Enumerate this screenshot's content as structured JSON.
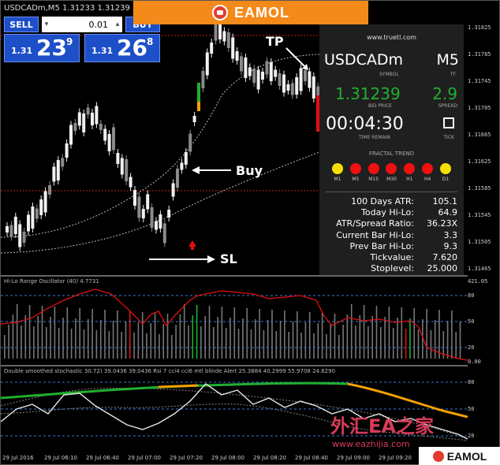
{
  "chart_header": {
    "symbol_line": "USDCADm,M5  1.31233 1.31239 1.31..."
  },
  "trade_panel": {
    "sell_label": "SELL",
    "buy_label": "BUY",
    "lot_value": "0.01",
    "bid": {
      "prefix": "1.31",
      "big": "23",
      "sup": "9"
    },
    "ask": {
      "prefix": "1.31",
      "big": "26",
      "sup": "8"
    }
  },
  "logo": {
    "text": "EAMOL"
  },
  "info_panel": {
    "site": "www.truetl.com",
    "symbol": "USDCADm",
    "symbol_caption": "SYMBOL",
    "timeframe": "M5",
    "timeframe_caption": "TF",
    "bid_price": "1.31239",
    "bid_caption": "BID PRICE",
    "spread": "2.9",
    "spread_caption": "SPREAD",
    "time_remain": "00:04:30",
    "time_caption": "TIME REMAIN",
    "tick_caption": "TICK",
    "fractal_title": "FRACTAL TREND",
    "fractal": [
      {
        "tf": "M1",
        "color": "#f5e000"
      },
      {
        "tf": "M5",
        "color": "#f01010"
      },
      {
        "tf": "M15",
        "color": "#f01010"
      },
      {
        "tf": "M30",
        "color": "#f01010"
      },
      {
        "tf": "H1",
        "color": "#f01010"
      },
      {
        "tf": "H4",
        "color": "#f01010"
      },
      {
        "tf": "D1",
        "color": "#f5e000"
      }
    ],
    "stats": [
      {
        "k": "100 Days ATR:",
        "v": "105.1"
      },
      {
        "k": "Today Hi-Lo:",
        "v": "64.9"
      },
      {
        "k": "ATR/Spread Ratio:",
        "v": "36.23X"
      },
      {
        "k": "Current Bar Hi-Lo:",
        "v": "3.3"
      },
      {
        "k": "Prev Bar Hi-Lo:",
        "v": "9.3"
      },
      {
        "k": "Tickvalue:",
        "v": "7.620"
      },
      {
        "k": "Stoplevel:",
        "v": "25.000"
      }
    ]
  },
  "annotations": {
    "tp": "TP",
    "buy": "Buy",
    "sl": "SL"
  },
  "price_axis": [
    "1.31825",
    "1.31785",
    "1.31745",
    "1.31705",
    "1.31665",
    "1.31625",
    "1.31585",
    "1.31545",
    "1.31505",
    "1.31465"
  ],
  "osc1": {
    "title": "Hi-Lo Range Oscillator (40) 4.7731",
    "axis": [
      "421.05",
      "80",
      "50",
      "20",
      "0.00"
    ]
  },
  "osc2": {
    "title": "Double smoothed stochastic 30.72) 39.0436 39.0436  Rsi 7 cci4 cci6 mtl  blinde Alert 25.3884 40.2999 55.9708 24.6290",
    "axis": [
      "80",
      "50",
      "20"
    ]
  },
  "time_axis": [
    "29 Jul 2016",
    "29 Jul 06:10",
    "29 Jul 06:40",
    "29 Jul 07:00",
    "29 Jul 07:20",
    "29 Jul 08:00",
    "29 Jul 08:20",
    "29 Jul 08:40",
    "29 Jul 09:00",
    "29 Jul 09:20",
    "29 Jul 09:40"
  ],
  "watermark": {
    "cn": "外汇EA之家",
    "url": "www.eazhijia.com"
  },
  "colors": {
    "bull": "#f0f0f0",
    "bear": "#8a8a8a",
    "green": "#20b030",
    "red": "#e01010",
    "orange": "#f4a000"
  }
}
